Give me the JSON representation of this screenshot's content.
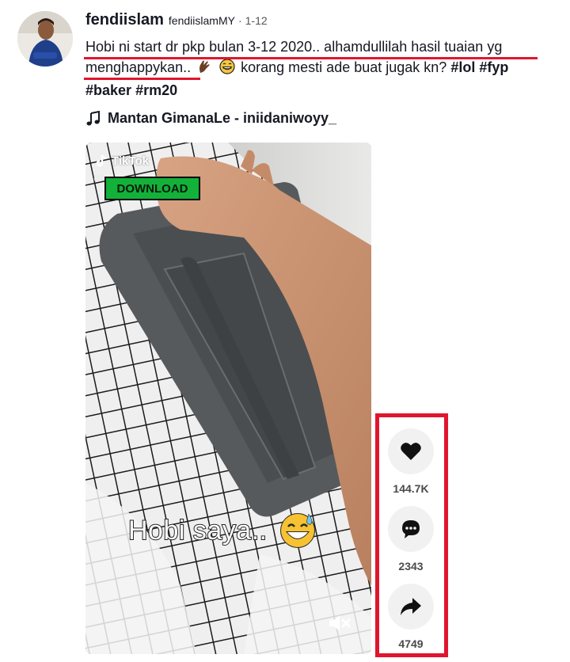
{
  "post": {
    "username": "fendiislam",
    "nickname": "fendiislamMY",
    "separator": "·",
    "date": "1-12",
    "caption_line1": "Hobi ni start dr pkp bulan 3-12 2020.. alhamdullilah hasil tuaian yg",
    "caption_line2_a": "menghappykan..",
    "caption_line2_b": "korang mesti ade buat jugak kn?",
    "hashtags": [
      "#lol",
      "#fyp",
      "#baker",
      "#rm20"
    ],
    "music": "Mantan GimanaLe - iniidaniwoyy_"
  },
  "video": {
    "watermark": "TikTok",
    "watermark_handle": "@f",
    "download_label": "DOWNLOAD",
    "overlay_text": "Hobi saya.."
  },
  "actions": {
    "likes": "144.7K",
    "comments": "2343",
    "shares": "4749"
  },
  "colors": {
    "highlight_red": "#e0162e",
    "download_green": "#13b13a",
    "action_bg": "#f1f1f2"
  },
  "icons": [
    "heart-icon",
    "comment-icon",
    "share-icon",
    "music-note-icon",
    "mute-icon",
    "tiktok-logo-icon"
  ]
}
